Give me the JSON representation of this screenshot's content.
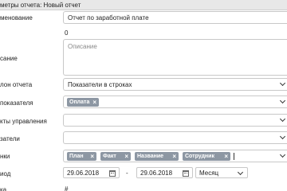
{
  "window": {
    "title": "метры отчета: Новый отчет"
  },
  "form": {
    "name": {
      "label": "менование",
      "value": "Отчет по заработной плате"
    },
    "code": {
      "value": "0"
    },
    "description": {
      "label": "сание",
      "placeholder": "Описание"
    },
    "template": {
      "label": "лон отчета",
      "value": "Показатели в строках"
    },
    "indicators": {
      "label": "показателя",
      "tags": [
        "Оплата"
      ]
    },
    "mgmt_objects": {
      "label": "кты управления"
    },
    "scenarios": {
      "label": "затели"
    },
    "columns": {
      "label": "нки",
      "tags": [
        "План",
        "Факт",
        "Название",
        "Сотрудник"
      ]
    },
    "period": {
      "label": "иод",
      "from": "29.06.2018",
      "separator": "-",
      "to": "29.06.2018",
      "granularity": "Месяц"
    },
    "bottom": {
      "label": "ка",
      "hash": "#"
    }
  },
  "icons": {
    "dropdown": "chevron-down-icon",
    "calendar": "calendar-icon",
    "remove": "close-icon"
  }
}
